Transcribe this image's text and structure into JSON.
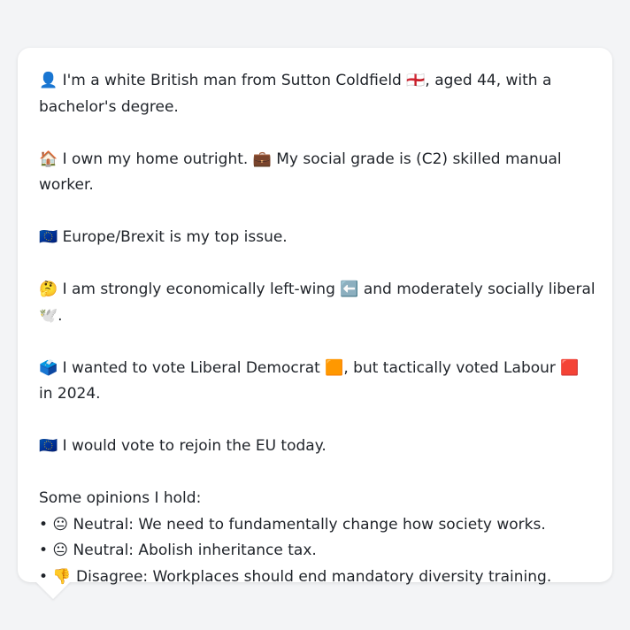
{
  "profile": {
    "line1": "👤 I'm a white British man from Sutton Coldfield 🏴󠁧󠁢󠁥󠁮󠁧󠁿, aged 44, with a bachelor's degree.",
    "line2": "🏠 I own my home outright. 💼 My social grade is (C2) skilled manual worker.",
    "line3": "🇪🇺 Europe/Brexit is my top issue.",
    "line4_text": "🤔 I am strongly economically left-wing ⬅️ and moderately socially liberal 🕊️.",
    "line5": "🗳️ I wanted to vote Liberal Democrat 🟧, but tactically voted Labour 🟥 in 2024.",
    "line6": "🇪🇺 I would vote to rejoin the EU today.",
    "opinions_heading": "Some opinions I hold:",
    "opinions": [
      "• 😐 Neutral: We need to fundamentally change how society works.",
      "• 😐 Neutral: Abolish inheritance tax.",
      "• 👎 Disagree: Workplaces should end mandatory diversity training."
    ]
  },
  "colors": {
    "background": "#f3f4f6",
    "bubble": "#ffffff",
    "text": "#1f2329",
    "libdem_orange": "#f79a1e",
    "labour_red": "#e2231a"
  }
}
